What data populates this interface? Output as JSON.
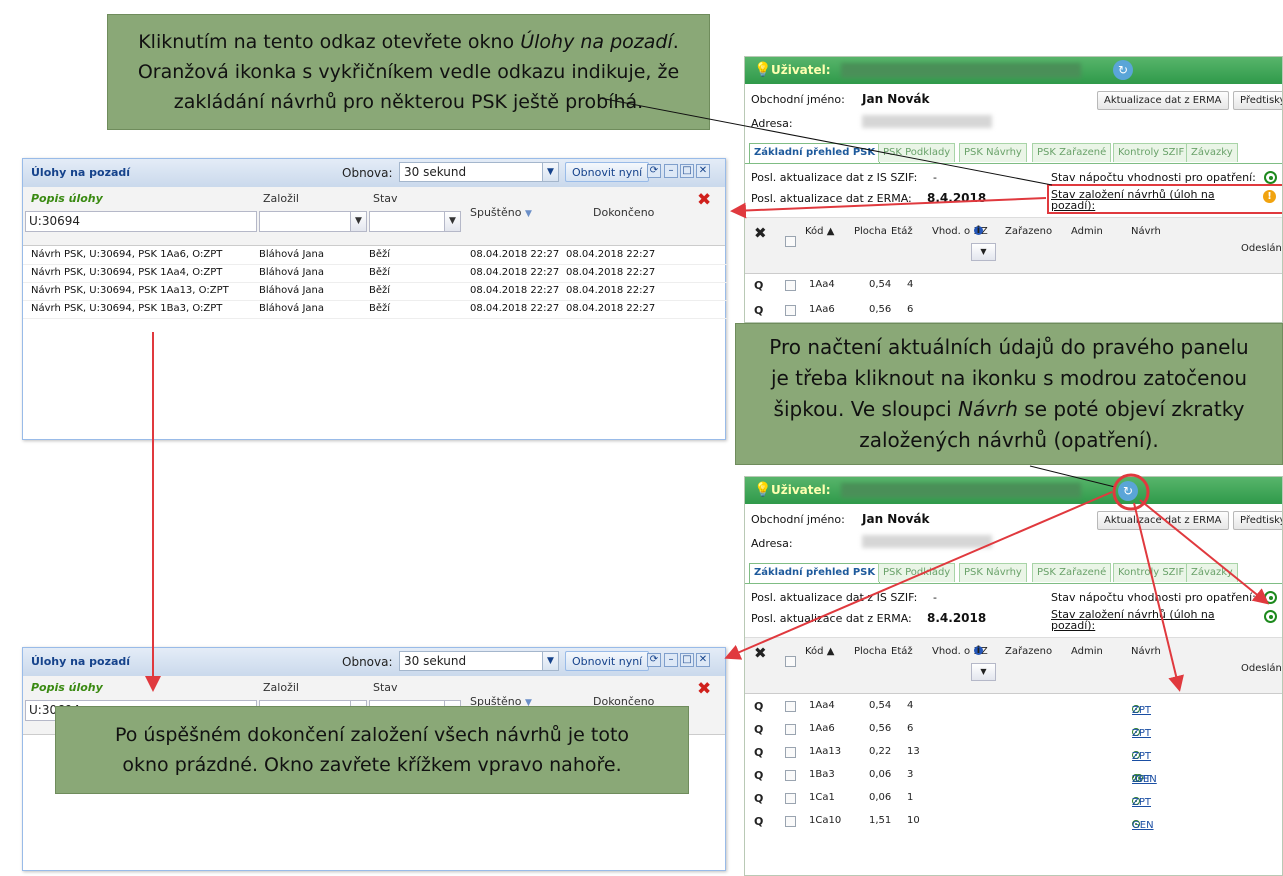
{
  "callouts": {
    "top": [
      "Kliknutím na tento odkaz otevřete okno ",
      "Úlohy na pozadí",
      ".",
      "Oranžová ikonka s vykřičníkem vedle odkazu indikuje, že",
      "zakládání návrhů pro některou PSK ještě probíhá."
    ],
    "middle": [
      "Pro načtení aktuálních údajů do pravého panelu",
      "je třeba kliknout na ikonku s modrou zatočenou",
      "šipkou. Ve sloupci ",
      "Návrh",
      " se poté objeví zkratky",
      "založených návrhů (opatření)."
    ],
    "bottom": [
      "Po úspěšném dokončení založení všech návrhů je toto",
      "okno prázdné. Okno zavřete křížkem vpravo nahoře."
    ]
  },
  "task_window": {
    "title": "Úlohy na pozadí",
    "refresh_label": "Obnova:",
    "refresh_value": "30 sekund",
    "refresh_now": "Obnovit nyní",
    "col_popis": "Popis úlohy",
    "col_zalozil": "Založil",
    "col_stav": "Stav",
    "col_spusteno": "Spuštěno",
    "col_dokonceno": "Dokončeno",
    "filter_value": "U:30694",
    "rows": [
      {
        "popis": "Návrh PSK, U:30694, PSK 1Aa6, O:ZPT",
        "zalozil": "Bláhová Jana",
        "stav": "Běží",
        "spusteno": "08.04.2018 22:27",
        "dokonceno": "08.04.2018 22:27"
      },
      {
        "popis": "Návrh PSK, U:30694, PSK 1Aa4, O:ZPT",
        "zalozil": "Bláhová Jana",
        "stav": "Běží",
        "spusteno": "08.04.2018 22:27",
        "dokonceno": "08.04.2018 22:27"
      },
      {
        "popis": "Návrh PSK, U:30694, PSK 1Aa13, O:ZPT",
        "zalozil": "Bláhová Jana",
        "stav": "Běží",
        "spusteno": "08.04.2018 22:27",
        "dokonceno": "08.04.2018 22:27"
      },
      {
        "popis": "Návrh PSK, U:30694, PSK 1Ba3, O:ZPT",
        "zalozil": "Bláhová Jana",
        "stav": "Běží",
        "spusteno": "08.04.2018 22:27",
        "dokonceno": "08.04.2018 22:27"
      }
    ]
  },
  "user_panel": {
    "user_label": "Uživatel:",
    "obchodni_label": "Obchodní jméno:",
    "obchodni_value": "Jan Novák",
    "adresa_label": "Adresa:",
    "btn_aktualizace": "Aktualizace dat z ERMA",
    "btn_predtisky": "Předtisky",
    "tabs": [
      "Základní přehled PSK",
      "PSK Podklady",
      "PSK Návrhy",
      "PSK Zařazené",
      "Kontroly SZIF",
      "Závazky"
    ],
    "posl_szif_label": "Posl. aktualizace dat z IS SZIF:",
    "posl_szif_value": "-",
    "posl_erma_label": "Posl. aktualizace dat z ERMA:",
    "posl_erma_value": "8.4.2018",
    "stav_napoctu": "Stav nápočtu vhodnosti pro opatření:",
    "stav_zalozeni_1": "Stav založení návrhů (úloh na",
    "stav_zalozeni_2": "pozadí):",
    "warn_glyph": "!",
    "cols": [
      "Kód ▲",
      "Plocha",
      "Etáž",
      "Vhod. o",
      "ZZ",
      "Zařazeno",
      "Admin",
      "Návrh",
      "Odesláno"
    ],
    "rows_top": [
      {
        "kod": "1Aa4",
        "plocha": "0,54",
        "etaz": "4"
      },
      {
        "kod": "1Aa6",
        "plocha": "0,56",
        "etaz": "6"
      }
    ],
    "rows_bottom": [
      {
        "kod": "1Aa4",
        "plocha": "0,54",
        "etaz": "4",
        "navrh": "ZPT",
        "navrh2": ""
      },
      {
        "kod": "1Aa6",
        "plocha": "0,56",
        "etaz": "6",
        "navrh": "ZPT",
        "navrh2": ""
      },
      {
        "kod": "1Aa13",
        "plocha": "0,22",
        "etaz": "13",
        "navrh": "ZPT",
        "navrh2": ""
      },
      {
        "kod": "1Ba3",
        "plocha": "0,06",
        "etaz": "3",
        "navrh": "ZPT",
        "navrh2": "GEN"
      },
      {
        "kod": "1Ca1",
        "plocha": "0,06",
        "etaz": "1",
        "navrh": "ZPT",
        "navrh2": ""
      },
      {
        "kod": "1Ca10",
        "plocha": "1,51",
        "etaz": "10",
        "navrh": "GEN",
        "navrh2": ""
      }
    ]
  },
  "icons": {
    "close": "red-x-icon",
    "refresh": "refresh-icon",
    "bulb": "bulb-icon"
  },
  "colors": {
    "callout": "#8aa877",
    "header_green": "#2f9a4a",
    "highlight_red": "#e0393e",
    "ok_green": "#1e8a1e",
    "warn_orange": "#f1a30f"
  }
}
